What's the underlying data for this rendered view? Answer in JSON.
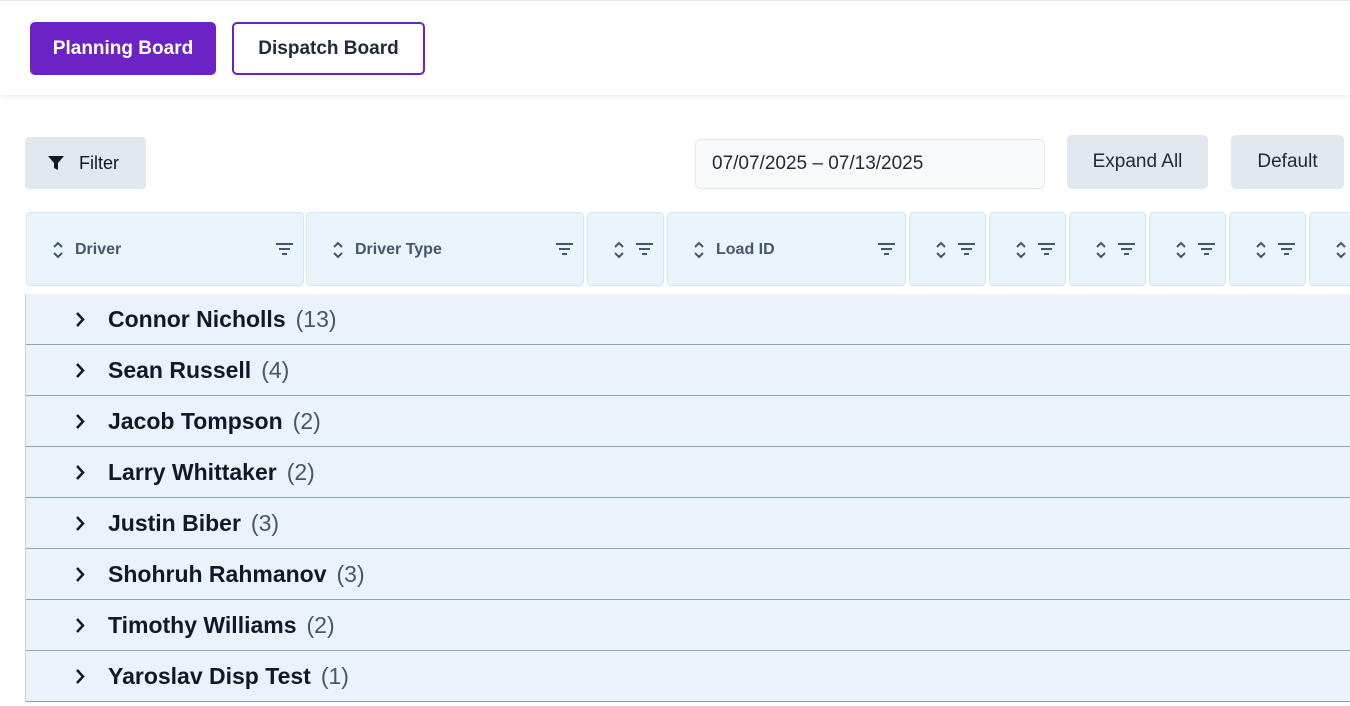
{
  "tabs": {
    "planning": "Planning Board",
    "dispatch": "Dispatch Board"
  },
  "toolbar": {
    "filter_label": "Filter",
    "date_range": "07/07/2025 – 07/13/2025",
    "expand_all": "Expand All",
    "default": "Default"
  },
  "columns": [
    {
      "label": "Driver"
    },
    {
      "label": "Driver Type"
    },
    {
      "label": ""
    },
    {
      "label": "Load ID"
    },
    {
      "label": ""
    },
    {
      "label": ""
    },
    {
      "label": ""
    },
    {
      "label": ""
    },
    {
      "label": ""
    },
    {
      "label": ""
    }
  ],
  "groups": [
    {
      "name": "Connor Nicholls",
      "count": "(13)"
    },
    {
      "name": "Sean Russell",
      "count": "(4)"
    },
    {
      "name": "Jacob Tompson",
      "count": "(2)"
    },
    {
      "name": "Larry Whittaker",
      "count": "(2)"
    },
    {
      "name": "Justin Biber",
      "count": "(3)"
    },
    {
      "name": "Shohruh Rahmanov",
      "count": "(3)"
    },
    {
      "name": "Timothy Williams",
      "count": "(2)"
    },
    {
      "name": "Yaroslav Disp Test",
      "count": "(1)"
    }
  ],
  "colors": {
    "accent": "#6d22c6",
    "header_bg": "#eaf4fd",
    "row_bg": "#eaf3fc"
  }
}
